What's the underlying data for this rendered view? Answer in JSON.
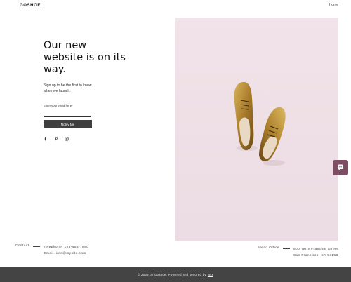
{
  "header": {
    "logo": "GOSHOE.",
    "nav_home": "Home"
  },
  "hero": {
    "headline": "Our new website is on its way.",
    "subtext": "Sign up to be the first to know when we launch.",
    "email_label": "Enter your email here*",
    "email_value": "",
    "notify_label": "Notify Me"
  },
  "social": [
    {
      "name": "facebook-icon"
    },
    {
      "name": "pinterest-icon"
    },
    {
      "name": "instagram-icon"
    }
  ],
  "contact": {
    "label": "Contact",
    "telephone": "Telephone. 123-456-7890",
    "email": "Email. info@mysite.com"
  },
  "office": {
    "label": "Head Office",
    "address_line1": "500 Terry Francine Street",
    "address_line2": "San Francisco, CA 94158"
  },
  "footer": {
    "text": "© 2035 by Goshoe. Powered and secured by",
    "link": "Wix"
  },
  "colors": {
    "photo_background": "#efe1e7",
    "button": "#3f3f3f",
    "chat_button": "#7c4d63",
    "footer": "#444444",
    "shoe_gold": "#a87b2a"
  }
}
